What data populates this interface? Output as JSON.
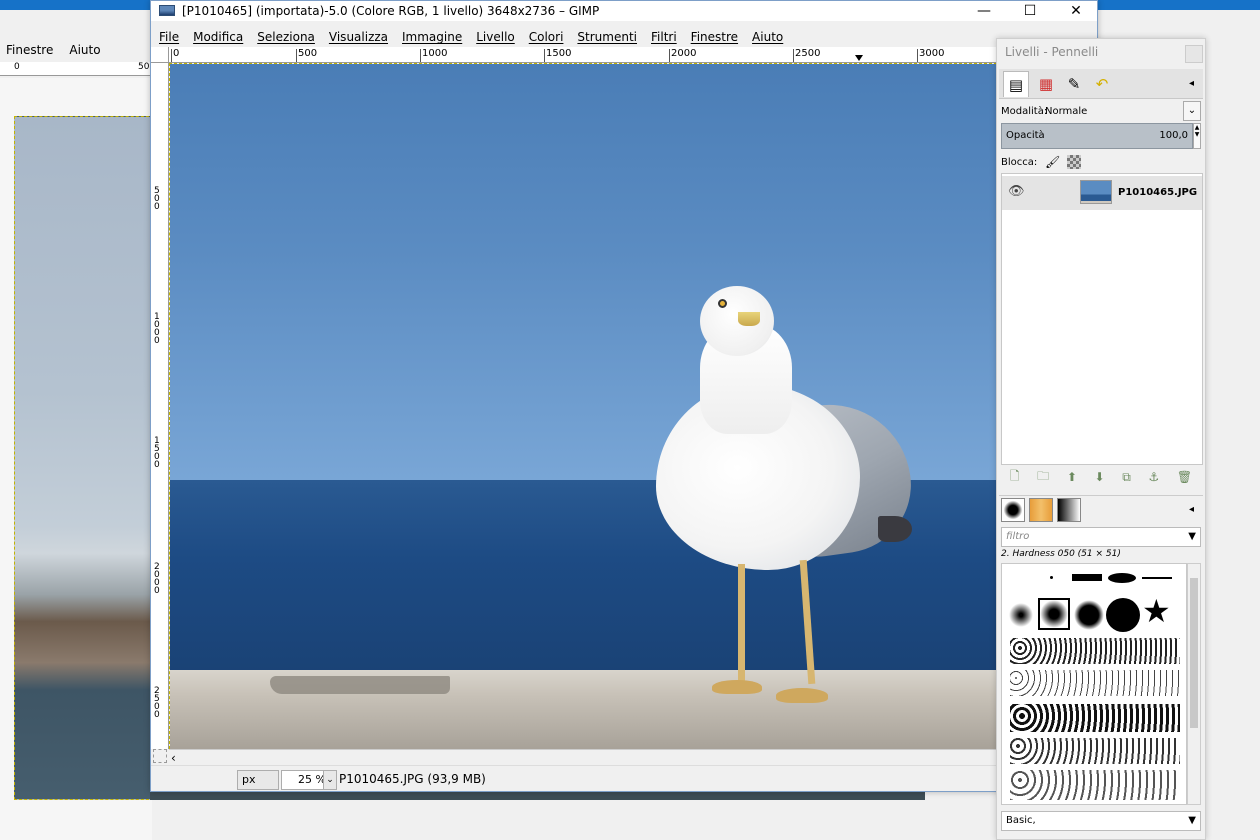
{
  "background_window": {
    "menu": [
      "Finestre",
      "Aiuto"
    ],
    "ruler_labels": [
      "0",
      "50"
    ]
  },
  "window": {
    "title": "[P1010465] (importata)-5.0 (Colore RGB, 1 livello) 3648x2736 – GIMP",
    "minimize_glyph": "—",
    "maximize_glyph": "☐",
    "close_glyph": "✕"
  },
  "menu": [
    "File",
    "Modifica",
    "Seleziona",
    "Visualizza",
    "Immagine",
    "Livello",
    "Colori",
    "Strumenti",
    "Filtri",
    "Finestre",
    "Aiuto"
  ],
  "hruler_labels": [
    "0",
    "500",
    "1000",
    "1500",
    "2000",
    "2500",
    "3000"
  ],
  "vruler_labels": [
    "5\n0\n0",
    "1\n0\n0\n0",
    "1\n5\n0\n0",
    "2\n0\n0\n0",
    "2\n5\n0\n0"
  ],
  "statusbar": {
    "unit": "px",
    "zoom": "25 %",
    "info": "P1010465.JPG (93,9 MB)"
  },
  "dock": {
    "title": "Livelli - Pennelli",
    "mode_label": "Modalità:",
    "mode_value": "Normale",
    "opacity_label": "Opacità",
    "opacity_value": "100,0",
    "lock_label": "Blocca:",
    "layer_name": "P1010465.JPG",
    "filter_placeholder": "filtro",
    "brush_name": "2. Hardness 050 (51 × 51)",
    "preset": "Basic,"
  },
  "icons": {
    "eye": "👁",
    "dropdown": "⌄",
    "triangle_menu": "◂",
    "scroll_left": "‹"
  }
}
